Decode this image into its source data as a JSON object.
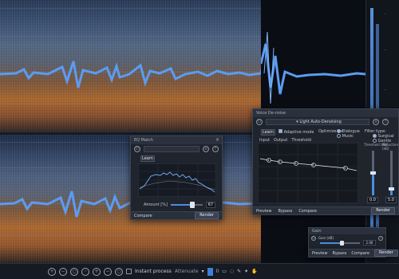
{
  "eq_match_window": {
    "title": "EQ Match",
    "learn_label": "Learn",
    "amount_label": "Amount [%]",
    "amount_value": "67",
    "amount_fraction": 0.67,
    "compare_label": "Compare",
    "render_label": "Render"
  },
  "denoise_window": {
    "title": "Voice De-noise",
    "preset_label": "Light Auto-Denoising",
    "learn_label": "Learn",
    "adaptive_mode_label": "Adaptive mode",
    "optimize_for_label": "Optimize for:",
    "opt_dialogue": "Dialogue",
    "opt_music": "Music",
    "filter_type_label": "Filter type:",
    "filter_surgical": "Surgical",
    "filter_gentle": "Gentle",
    "input_label": "Input",
    "output_label": "Output",
    "threshold_label": "Threshold",
    "threshold_db_label": "Threshold [dB]",
    "reduction_db_label": "Reduction [dB]",
    "threshold_value": "0.0",
    "reduction_value": "5.0",
    "threshold_fraction": 0.5,
    "reduction_fraction": 0.15,
    "node_labels": [
      "1",
      "2",
      "3",
      "4",
      "5"
    ],
    "preview_label": "Preview",
    "bypass_label": "Bypass",
    "compare_label": "Compare",
    "render_label": "Render"
  },
  "gain_window": {
    "title": "Gain",
    "gain_label": "Gain [dB]",
    "gain_value": "2.00",
    "gain_fraction": 0.55,
    "preview_label": "Preview",
    "bypass_label": "Bypass",
    "compare_label": "Compare",
    "render_label": "Render"
  },
  "toolbar": {
    "instant_process_label": "Instant process",
    "mode_label": "Attenuate",
    "icons": [
      "zoom-in-icon",
      "zoom-out-icon",
      "zoom-fit-icon",
      "zoom-selection-icon",
      "zoom-vertical-in-icon",
      "zoom-vertical-out-icon",
      "zoom-reset-icon"
    ],
    "tool_icons": [
      "time-selection-icon",
      "frequency-selection-icon",
      "time-freq-selection-icon",
      "lasso-icon",
      "brush-icon",
      "magic-wand-icon",
      "hand-icon"
    ]
  },
  "colors": {
    "waveform": "#5b9cf2",
    "accent": "#4c8ce0"
  }
}
